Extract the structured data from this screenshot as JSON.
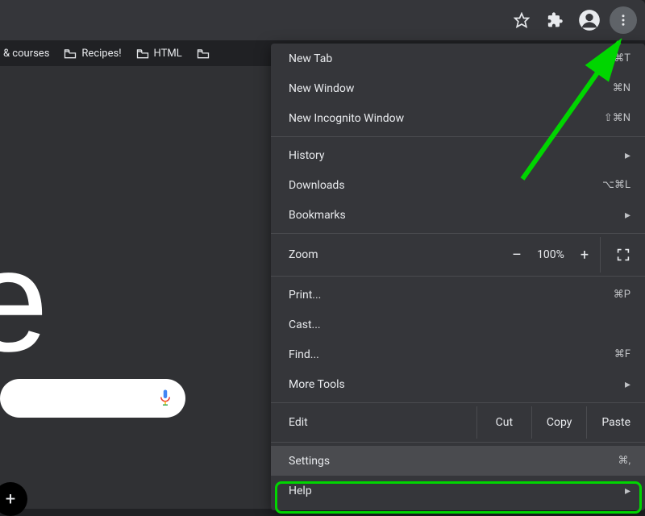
{
  "toolbar": {
    "star": "☆",
    "puzzle": "★",
    "profile": "●",
    "kebab": "⋮"
  },
  "bookmarks": [
    {
      "label": "& courses"
    },
    {
      "label": "Recipes!"
    },
    {
      "label": "HTML"
    },
    {
      "label": ""
    }
  ],
  "logo_fragment": "e",
  "plus_label": "+",
  "menu": {
    "new_tab": {
      "label": "New Tab",
      "shortcut": "⌘T"
    },
    "new_window": {
      "label": "New Window",
      "shortcut": "⌘N"
    },
    "new_incognito": {
      "label": "New Incognito Window",
      "shortcut": "⇧⌘N"
    },
    "history": {
      "label": "History"
    },
    "downloads": {
      "label": "Downloads",
      "shortcut": "⌥⌘L"
    },
    "bookmarks": {
      "label": "Bookmarks"
    },
    "zoom": {
      "label": "Zoom",
      "value": "100%",
      "minus": "–",
      "plus": "+"
    },
    "print": {
      "label": "Print...",
      "shortcut": "⌘P"
    },
    "cast": {
      "label": "Cast..."
    },
    "find": {
      "label": "Find...",
      "shortcut": "⌘F"
    },
    "more_tools": {
      "label": "More Tools"
    },
    "edit": {
      "label": "Edit",
      "cut": "Cut",
      "copy": "Copy",
      "paste": "Paste"
    },
    "settings": {
      "label": "Settings",
      "shortcut": "⌘,"
    },
    "help": {
      "label": "Help"
    }
  }
}
